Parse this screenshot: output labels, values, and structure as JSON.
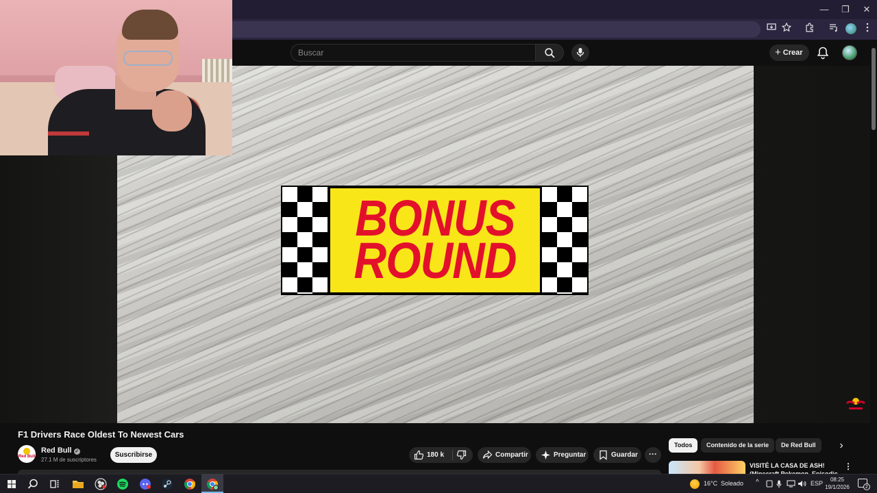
{
  "browser": {
    "window_controls": {
      "minimize": "—",
      "restore": "❐",
      "close": "✕"
    },
    "toolbar_icons": [
      "install-app-icon",
      "star-icon",
      "extensions-icon",
      "media-queue-icon",
      "profile-icon",
      "kebab-menu-icon"
    ]
  },
  "youtube_header": {
    "search_placeholder": "Buscar",
    "create_label": "Crear",
    "icons": [
      "search-icon",
      "mic-icon",
      "bell-icon",
      "avatar"
    ]
  },
  "video": {
    "overlay_line1": "BONUS",
    "overlay_line2": "ROUND",
    "colors": {
      "banner_yellow": "#f9e619",
      "banner_red": "#e3102c"
    }
  },
  "video_info": {
    "title": "F1 Drivers Race Oldest To Newest Cars",
    "channel": {
      "name": "Red Bull",
      "avatar_text": "Red Bull",
      "verified_mark": "✓",
      "subscribers": "27.1 M de suscriptores",
      "subscribe_label": "Suscribirse"
    },
    "actions": {
      "like_count": "180 k",
      "share": "Compartir",
      "ask": "Preguntar",
      "save": "Guardar",
      "more": "···"
    }
  },
  "sidebar": {
    "chips": [
      "Todos",
      "Contenido de la serie",
      "De Red Bull"
    ],
    "next_arrow": "›",
    "recommendation": {
      "title_line1": "VISITÉ LA CASA DE ASH!",
      "title_line2": "(Minecraft Pokemon, Episodio",
      "more": "⋮"
    }
  },
  "taskbar": {
    "apps": [
      "windows-start-icon",
      "search-icon",
      "task-view-icon",
      "file-explorer-icon",
      "obs-icon",
      "spotify-icon",
      "discord-icon",
      "steam-icon",
      "chrome-icon",
      "chrome-active-icon"
    ],
    "weather_temp": "16°C",
    "weather_text": "Soleado",
    "language": "ESP",
    "time": "08:25",
    "date": "19/1/2026",
    "notifications": "2"
  }
}
